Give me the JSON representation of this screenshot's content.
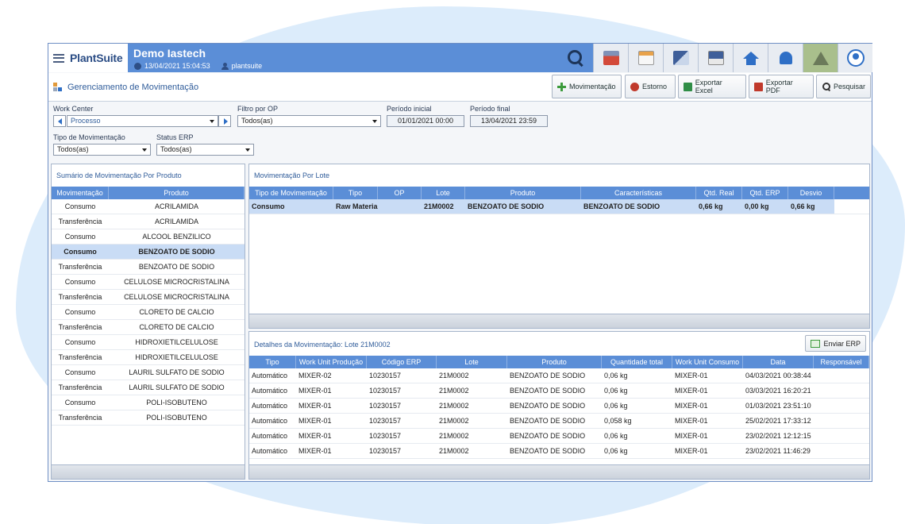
{
  "app": {
    "brand": "PlantSuite",
    "title": "Demo Iastech",
    "datetime": "13/04/2021 15:04:53",
    "user": "plantsuite"
  },
  "page": {
    "title": "Gerenciamento de Movimentação",
    "actions": {
      "movimentacao": "Movimentação",
      "estorno": "Estorno",
      "export_excel": "Exportar Excel",
      "export_pdf": "Exportar PDF",
      "search": "Pesquisar"
    }
  },
  "filters": {
    "work_center": {
      "label": "Work Center",
      "value": "Processo"
    },
    "filtro_op": {
      "label": "Filtro por OP",
      "value": "Todos(as)"
    },
    "periodo_inicial": {
      "label": "Período inicial",
      "value": "01/01/2021 00:00"
    },
    "periodo_final": {
      "label": "Período final",
      "value": "13/04/2021 23:59"
    },
    "tipo_mov": {
      "label": "Tipo de Movimentação",
      "value": "Todos(as)"
    },
    "status_erp": {
      "label": "Status ERP",
      "value": "Todos(as)"
    }
  },
  "summary": {
    "title": "Sumário de Movimentação Por Produto",
    "columns": [
      "Movimentação",
      "Produto"
    ],
    "selected_index": 3,
    "rows": [
      [
        "Consumo",
        "ACRILAMIDA"
      ],
      [
        "Transferência",
        "ACRILAMIDA"
      ],
      [
        "Consumo",
        "ALCOOL BENZILICO"
      ],
      [
        "Consumo",
        "BENZOATO DE SODIO"
      ],
      [
        "Transferência",
        "BENZOATO DE SODIO"
      ],
      [
        "Consumo",
        "CELULOSE MICROCRISTALINA"
      ],
      [
        "Transferência",
        "CELULOSE MICROCRISTALINA"
      ],
      [
        "Consumo",
        "CLORETO DE CALCIO"
      ],
      [
        "Transferência",
        "CLORETO DE CALCIO"
      ],
      [
        "Consumo",
        "HIDROXIETILCELULOSE"
      ],
      [
        "Transferência",
        "HIDROXIETILCELULOSE"
      ],
      [
        "Consumo",
        "LAURIL SULFATO DE SODIO"
      ],
      [
        "Transferência",
        "LAURIL SULFATO DE SODIO"
      ],
      [
        "Consumo",
        "POLI-ISOBUTENO"
      ],
      [
        "Transferência",
        "POLI-ISOBUTENO"
      ]
    ]
  },
  "lote": {
    "title": "Movimentação Por Lote",
    "columns": [
      "Tipo de Movimentação",
      "Tipo",
      "OP",
      "Lote",
      "Produto",
      "Características",
      "Qtd. Real",
      "Qtd. ERP",
      "Desvio"
    ],
    "rows": [
      [
        "Consumo",
        "Raw Material",
        "",
        "21M0002",
        "BENZOATO DE SODIO",
        "BENZOATO DE SODIO",
        "0,66 kg",
        "0,00 kg",
        "0,66 kg"
      ]
    ]
  },
  "details": {
    "title": "Detalhes da Movimentação: Lote 21M0002",
    "send_label": "Enviar ERP",
    "columns": [
      "Tipo",
      "Work Unit Produção",
      "Código ERP",
      "Lote",
      "Produto",
      "Quantidade total",
      "Work Unit Consumo",
      "Data",
      "Responsável"
    ],
    "rows": [
      [
        "Automático",
        "MIXER-02",
        "10230157",
        "21M0002",
        "BENZOATO DE SODIO",
        "0,06 kg",
        "MIXER-01",
        "04/03/2021 00:38:44",
        ""
      ],
      [
        "Automático",
        "MIXER-01",
        "10230157",
        "21M0002",
        "BENZOATO DE SODIO",
        "0,06 kg",
        "MIXER-01",
        "03/03/2021 16:20:21",
        ""
      ],
      [
        "Automático",
        "MIXER-01",
        "10230157",
        "21M0002",
        "BENZOATO DE SODIO",
        "0,06 kg",
        "MIXER-01",
        "01/03/2021 23:51:10",
        ""
      ],
      [
        "Automático",
        "MIXER-01",
        "10230157",
        "21M0002",
        "BENZOATO DE SODIO",
        "0,058 kg",
        "MIXER-01",
        "25/02/2021 17:33:12",
        ""
      ],
      [
        "Automático",
        "MIXER-01",
        "10230157",
        "21M0002",
        "BENZOATO DE SODIO",
        "0,06 kg",
        "MIXER-01",
        "23/02/2021 12:12:15",
        ""
      ],
      [
        "Automático",
        "MIXER-01",
        "10230157",
        "21M0002",
        "BENZOATO DE SODIO",
        "0,06 kg",
        "MIXER-01",
        "23/02/2021 11:46:29",
        ""
      ]
    ]
  },
  "icons": {
    "menu": "menu-icon",
    "clock": "clock-icon",
    "user": "user-icon",
    "search": "search-icon",
    "home": "home-icon",
    "bell": "bell-icon",
    "alert": "warning-icon",
    "profile": "profile-icon"
  },
  "colors": {
    "header": "#5b8ed7",
    "accent": "#2f5c9a",
    "selected_row": "#c9dcf5",
    "alert_bg": "#a9bf8c"
  }
}
